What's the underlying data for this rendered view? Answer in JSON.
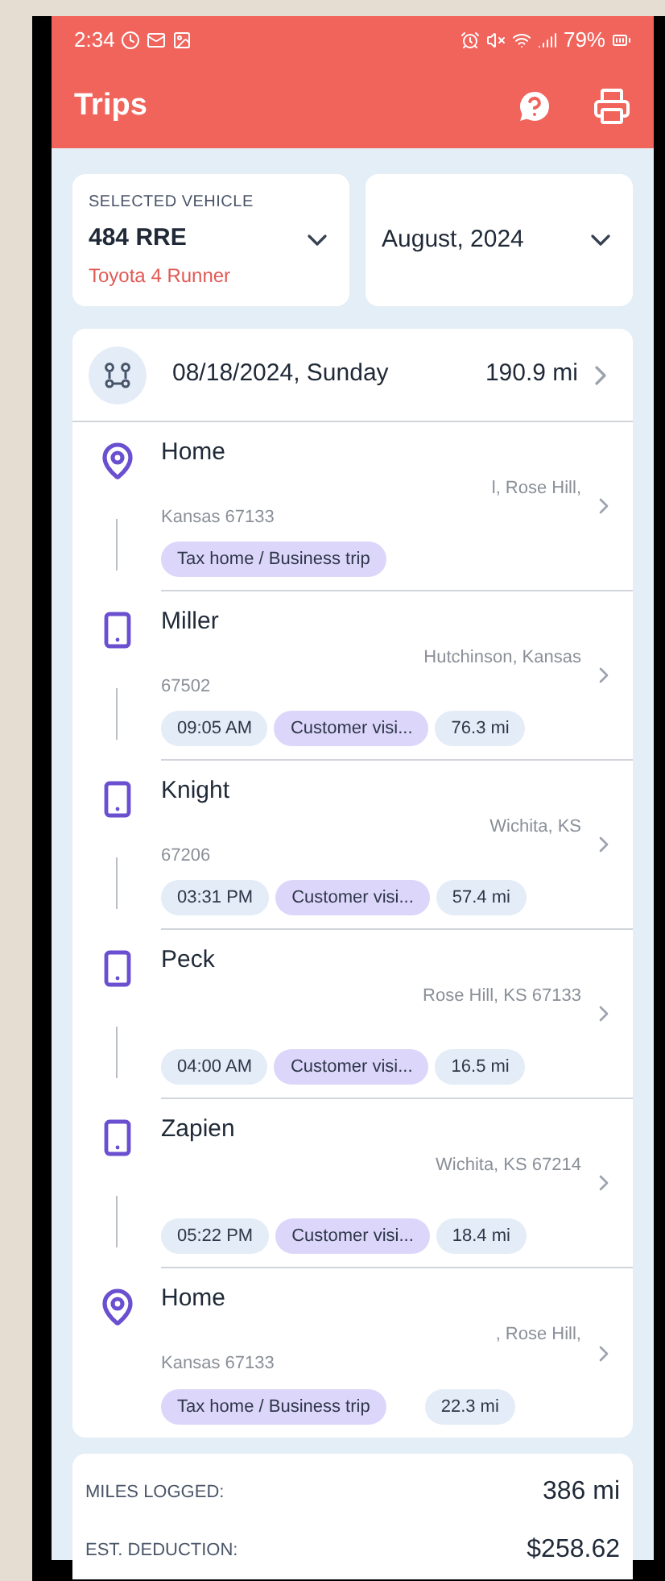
{
  "status_bar": {
    "time": "2:34",
    "battery": "79%"
  },
  "app_bar": {
    "title": "Trips"
  },
  "vehicle_selector": {
    "label": "SELECTED VEHICLE",
    "value": "484 RRE",
    "subtitle": "Toyota 4 Runner"
  },
  "month_selector": {
    "value": "August, 2024"
  },
  "trip": {
    "date": "08/18/2024, Sunday",
    "distance": "190.9 mi",
    "stops": [
      {
        "kind": "place",
        "name": "Home",
        "address_line1": "l, Rose Hill,",
        "address_line2": "Kansas 67133",
        "tags": [
          {
            "kind": "category",
            "text": "Tax home / Business trip"
          }
        ]
      },
      {
        "kind": "phone",
        "name": "Miller",
        "address_line1": "Hutchinson, Kansas",
        "address_line2": "67502",
        "tags": [
          {
            "kind": "time",
            "text": "09:05 AM"
          },
          {
            "kind": "category",
            "text": "Customer visi..."
          },
          {
            "kind": "distance",
            "text": "76.3 mi"
          }
        ]
      },
      {
        "kind": "phone",
        "name": "Knight",
        "address_line1": "Wichita, KS",
        "address_line2": "67206",
        "tags": [
          {
            "kind": "time",
            "text": "03:31 PM"
          },
          {
            "kind": "category",
            "text": "Customer visi..."
          },
          {
            "kind": "distance",
            "text": "57.4 mi"
          }
        ]
      },
      {
        "kind": "phone",
        "name": "Peck",
        "address_line1": "Rose Hill, KS 67133",
        "tags": [
          {
            "kind": "time",
            "text": "04:00 AM"
          },
          {
            "kind": "category",
            "text": "Customer visi..."
          },
          {
            "kind": "distance",
            "text": "16.5 mi"
          }
        ]
      },
      {
        "kind": "phone",
        "name": "Zapien",
        "address_line1": "Wichita, KS 67214",
        "tags": [
          {
            "kind": "time",
            "text": "05:22 PM"
          },
          {
            "kind": "category",
            "text": "Customer visi..."
          },
          {
            "kind": "distance",
            "text": "18.4 mi"
          }
        ]
      },
      {
        "kind": "place",
        "name": "Home",
        "address_line1": ", Rose Hill,",
        "address_line2": "Kansas 67133",
        "tags": [
          {
            "kind": "category",
            "text": "Tax home / Business trip"
          },
          {
            "kind": "distance",
            "text": "22.3 mi"
          }
        ]
      }
    ]
  },
  "summary": [
    {
      "label": "MILES LOGGED:",
      "value": "386 mi"
    },
    {
      "label": "EST. DEDUCTION:",
      "value": "$258.62"
    }
  ]
}
